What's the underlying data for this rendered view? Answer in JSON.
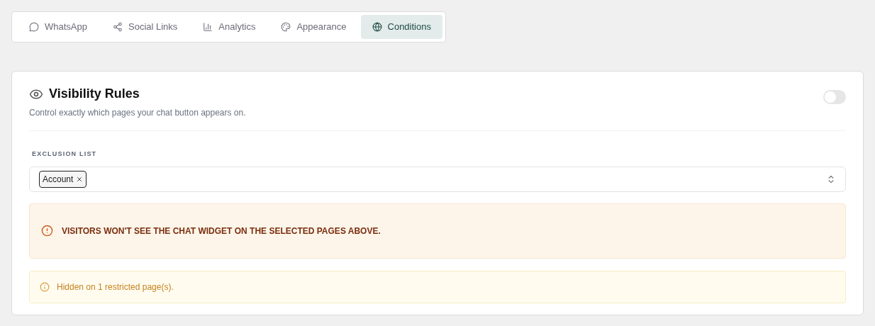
{
  "tabs": [
    {
      "label": "WhatsApp",
      "kind": "chat",
      "selected": false
    },
    {
      "label": "Social Links",
      "kind": "share",
      "selected": false
    },
    {
      "label": "Analytics",
      "kind": "chart",
      "selected": false
    },
    {
      "label": "Appearance",
      "kind": "palette",
      "selected": false
    },
    {
      "label": "Conditions",
      "kind": "globe",
      "selected": true
    }
  ],
  "visibility": {
    "title": "Visibility Rules",
    "description": "Control exactly which pages your chat button appears on.",
    "on": false,
    "exclusion_label": "EXCLUSION LIST",
    "tags": [
      "Account"
    ],
    "warning": "VISITORS WON'T SEE THE CHAT WIDGET ON THE SELECTED PAGES ABOVE.",
    "info": "Hidden on 1 restricted page(s)."
  }
}
